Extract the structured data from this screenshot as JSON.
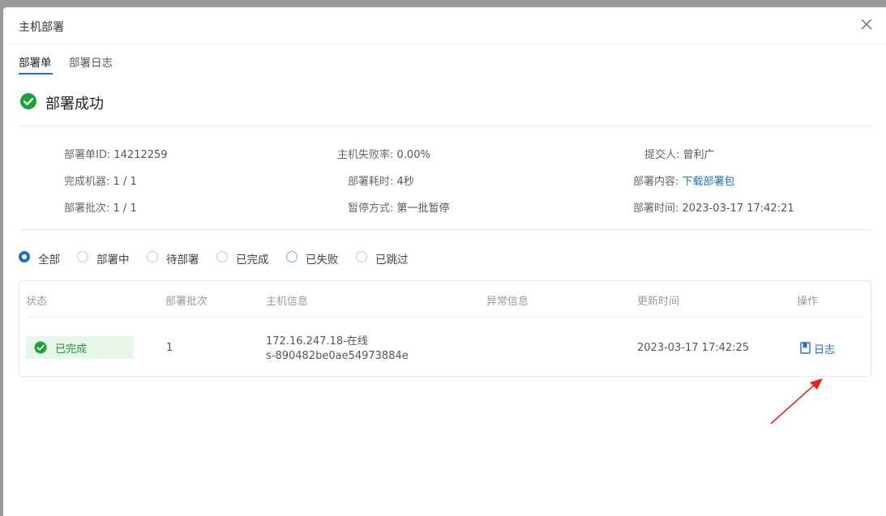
{
  "modal": {
    "title": "主机部署"
  },
  "tabs": [
    {
      "label": "部署单",
      "active": true
    },
    {
      "label": "部署日志",
      "active": false
    }
  ],
  "status": {
    "icon": "check-circle-icon",
    "text": "部署成功",
    "color": "#1ea13a"
  },
  "info": {
    "order_id": {
      "label": "部署单ID:",
      "value": "14212259"
    },
    "fail_rate": {
      "label": "主机失败率:",
      "value": "0.00%"
    },
    "submitter": {
      "label": "提交人:",
      "value": "曾利广"
    },
    "finished_machines": {
      "label": "完成机器:",
      "value": "1 / 1"
    },
    "duration": {
      "label": "部署耗时:",
      "value": "4秒"
    },
    "content": {
      "label": "部署内容:",
      "value": "下载部署包"
    },
    "batches": {
      "label": "部署批次:",
      "value": "1 / 1"
    },
    "pause_mode": {
      "label": "暂停方式:",
      "value": "第一批暂停"
    },
    "deploy_time": {
      "label": "部署时间:",
      "value": "2023-03-17 17:42:21"
    }
  },
  "filters": [
    {
      "label": "全部",
      "checked": true
    },
    {
      "label": "部署中",
      "checked": false
    },
    {
      "label": "待部署",
      "checked": false
    },
    {
      "label": "已完成",
      "checked": false
    },
    {
      "label": "已失败",
      "checked": false
    },
    {
      "label": "已跳过",
      "checked": false
    }
  ],
  "table": {
    "columns": [
      "状态",
      "部署批次",
      "主机信息",
      "异常信息",
      "更新时间",
      "操作"
    ],
    "rows": [
      {
        "status": "已完成",
        "batch": "1",
        "host_line1": "172.16.247.18-在线",
        "host_line2": "s-890482be0ae54973884e",
        "error": "",
        "updated": "2023-03-17 17:42:25",
        "action": "日志"
      }
    ]
  },
  "colors": {
    "accent": "#1f6fbf",
    "success": "#1ea13a",
    "success_bg": "#e8f6ea",
    "annotation_arrow": "#e8231f"
  }
}
